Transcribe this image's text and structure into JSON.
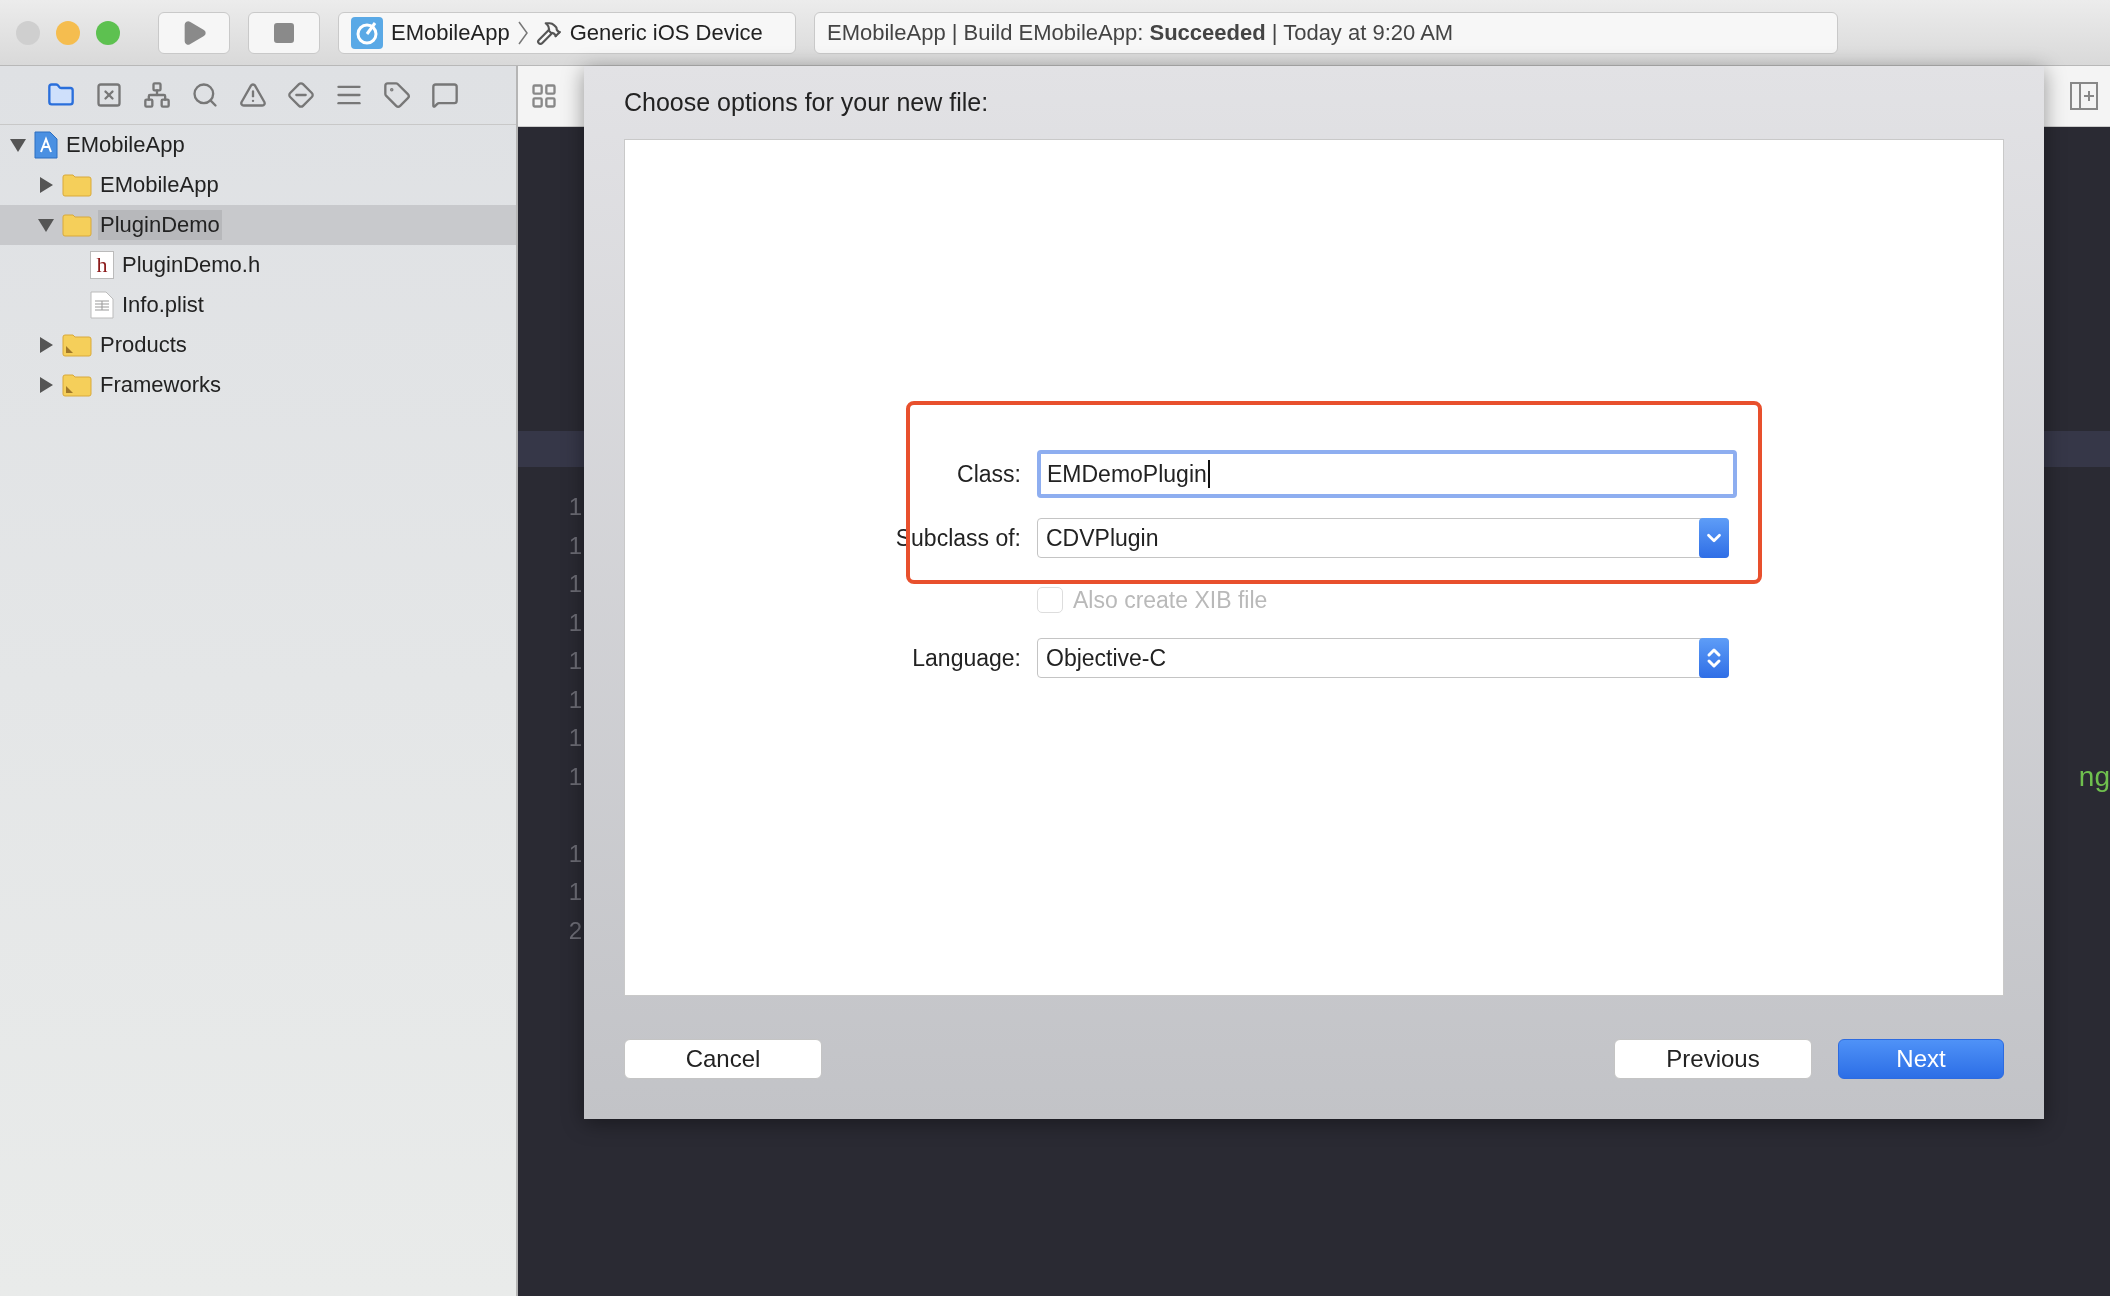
{
  "toolbar": {
    "window_controls": [
      {
        "color": "#cfcfcf"
      },
      {
        "color": "#f5bd4f"
      },
      {
        "color": "#5dc150"
      }
    ],
    "scheme": {
      "project": "EMobileApp",
      "destination": "Generic iOS Device"
    },
    "activity": "EMobileApp | Build EMobileApp: **Succeeded** | Today at 9:20 AM"
  },
  "navigator": {
    "tabs": [
      {
        "kind": "folder",
        "selected": true
      },
      {
        "kind": "boxed-x",
        "selected": false
      },
      {
        "kind": "hierarchy",
        "selected": false
      },
      {
        "kind": "search",
        "selected": false
      },
      {
        "kind": "warning",
        "selected": false
      },
      {
        "kind": "diamond",
        "selected": false
      },
      {
        "kind": "list",
        "selected": false
      },
      {
        "kind": "tag",
        "selected": false
      },
      {
        "kind": "speech",
        "selected": false
      }
    ],
    "tree": [
      {
        "label": "EMobileApp",
        "kind": "project",
        "expanded": true,
        "selected": false,
        "children": [
          {
            "label": "EMobileApp",
            "kind": "folder",
            "expanded": false,
            "selected": false
          },
          {
            "label": "PluginDemo",
            "kind": "folder",
            "expanded": true,
            "selected": true,
            "children": [
              {
                "label": "PluginDemo.h",
                "kind": "header",
                "badge": "h",
                "selected": false
              },
              {
                "label": "Info.plist",
                "kind": "plist",
                "selected": false
              }
            ]
          },
          {
            "label": "Products",
            "kind": "special-folder",
            "expanded": false,
            "selected": false
          },
          {
            "label": "Frameworks",
            "kind": "special-folder",
            "expanded": false,
            "selected": false
          }
        ]
      }
    ]
  },
  "editor": {
    "lines": [
      {
        "kind": "numbered",
        "number": "1"
      },
      {
        "kind": "numbered",
        "number": "1"
      },
      {
        "kind": "numbered",
        "number": "1"
      },
      {
        "kind": "numbered",
        "number": "1"
      },
      {
        "kind": "numbered",
        "number": "1"
      },
      {
        "kind": "numbered",
        "number": "1"
      },
      {
        "kind": "numbered",
        "number": "1"
      },
      {
        "kind": "numbered",
        "number": "1",
        "code": "ng"
      },
      {
        "kind": "blank"
      },
      {
        "kind": "numbered",
        "number": "1"
      },
      {
        "kind": "numbered",
        "number": "1"
      },
      {
        "kind": "numbered",
        "number": "2"
      }
    ]
  },
  "sheet": {
    "title": "Choose options for your new file:",
    "fields": [
      {
        "kind": "text",
        "label": "Class:",
        "value": "EMDemoPlugin",
        "focused": true
      },
      {
        "kind": "popup",
        "label": "Subclass of:",
        "value": "CDVPlugin"
      },
      {
        "kind": "checkbox",
        "label": "Also create XIB file",
        "checked": false,
        "disabled": true
      },
      {
        "kind": "stepper",
        "label": "Language:",
        "value": "Objective-C"
      }
    ],
    "buttons": [
      {
        "label": "Cancel",
        "kind": "normal"
      },
      {
        "label": "Previous",
        "kind": "normal"
      },
      {
        "label": "Next",
        "kind": "default"
      }
    ]
  }
}
